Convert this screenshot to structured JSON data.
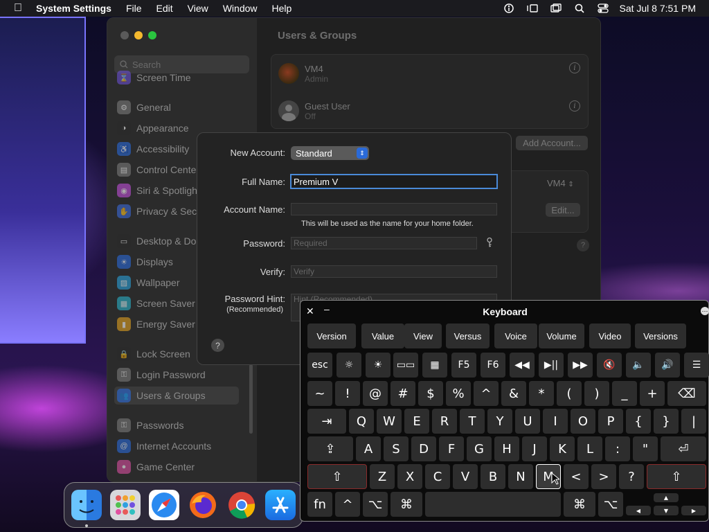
{
  "menubar": {
    "app": "System Settings",
    "items": [
      "File",
      "Edit",
      "View",
      "Window",
      "Help"
    ],
    "clock": "Sat Jul 8  7:51 PM",
    "icons": [
      "apple-icon",
      "accessibility-icon",
      "stage-manager-icon",
      "window-icon",
      "search-icon",
      "control-center-icon"
    ]
  },
  "sidebar": {
    "search_placeholder": "Search",
    "items": [
      {
        "label": "Screen Time",
        "icon": "hourglass-icon",
        "color": "#6a4fd0"
      },
      {
        "label": "General",
        "icon": "gear-icon",
        "color": "#7a7a7a"
      },
      {
        "label": "Appearance",
        "icon": "appearance-icon",
        "color": "#2a2a2a"
      },
      {
        "label": "Accessibility",
        "icon": "accessibility-icon",
        "color": "#2a6ad8"
      },
      {
        "label": "Control Center",
        "icon": "control-center-icon",
        "color": "#7a7a7a"
      },
      {
        "label": "Siri & Spotlight",
        "icon": "siri-icon",
        "color": "#c04fd8"
      },
      {
        "label": "Privacy & Security",
        "icon": "hand-icon",
        "color": "#3a6ad8"
      },
      {
        "label": "Desktop & Dock",
        "icon": "desktop-icon",
        "color": "#2a2a2a"
      },
      {
        "label": "Displays",
        "icon": "sun-icon",
        "color": "#2a6ad8"
      },
      {
        "label": "Wallpaper",
        "icon": "wallpaper-icon",
        "color": "#2aa0d8"
      },
      {
        "label": "Screen Saver",
        "icon": "screensaver-icon",
        "color": "#2ab0c8"
      },
      {
        "label": "Energy Saver",
        "icon": "battery-icon",
        "color": "#e0a020"
      },
      {
        "label": "Lock Screen",
        "icon": "lock-icon",
        "color": "#2a2a2a"
      },
      {
        "label": "Login Password",
        "icon": "key-icon",
        "color": "#7a7a7a"
      },
      {
        "label": "Users & Groups",
        "icon": "users-icon",
        "color": "#2a6ad8"
      },
      {
        "label": "Passwords",
        "icon": "key-icon",
        "color": "#7a7a7a"
      },
      {
        "label": "Internet Accounts",
        "icon": "at-icon",
        "color": "#2a6ad8"
      },
      {
        "label": "Game Center",
        "icon": "game-center-icon",
        "color": "#d84fa0"
      }
    ]
  },
  "content": {
    "title": "Users & Groups",
    "users": [
      {
        "name": "VM4",
        "role": "Admin"
      },
      {
        "name": "Guest User",
        "role": "Off"
      }
    ],
    "add_account": "Add Account...",
    "auto_login_value": "VM4",
    "edit": "Edit..."
  },
  "dialog": {
    "new_account_label": "New Account:",
    "new_account_value": "Standard",
    "full_name_label": "Full Name:",
    "full_name_value": "Premium V",
    "account_name_label": "Account Name:",
    "account_name_hint": "This will be used as the name for your home folder.",
    "password_label": "Password:",
    "password_placeholder": "Required",
    "verify_label": "Verify:",
    "verify_placeholder": "Verify",
    "hint_label": "Password Hint:",
    "hint_sub": "(Recommended)",
    "hint_placeholder": "Hint (Recommended)",
    "help": "?"
  },
  "keyboard": {
    "title": "Keyboard",
    "predictions": [
      "Version",
      "Value",
      "View",
      "Versus",
      "Voice",
      "Volume",
      "Video",
      "Versions"
    ],
    "fn_row": [
      "esc",
      "F5",
      "F6"
    ],
    "row1": [
      "~",
      "!",
      "@",
      "#",
      "$",
      "%",
      "^",
      "&",
      "*",
      "(",
      ")",
      "_",
      "+"
    ],
    "row2": [
      "Q",
      "W",
      "E",
      "R",
      "T",
      "Y",
      "U",
      "I",
      "O",
      "P",
      "{",
      "}",
      "|"
    ],
    "row3": [
      "A",
      "S",
      "D",
      "F",
      "G",
      "H",
      "J",
      "K",
      "L",
      ":",
      "\""
    ],
    "row4": [
      "Z",
      "X",
      "C",
      "V",
      "B",
      "N",
      "M",
      "<",
      ">",
      "?"
    ],
    "bottom": {
      "fn": "fn",
      "ctrl": "^",
      "opt": "⌥",
      "cmd": "⌘"
    },
    "arrows": [
      "▲",
      "◀",
      "▼",
      "▶"
    ],
    "highlighted_key": "M"
  },
  "dock": {
    "apps": [
      "Finder",
      "Launchpad",
      "Safari",
      "Firefox",
      "Chrome",
      "App Store"
    ]
  }
}
